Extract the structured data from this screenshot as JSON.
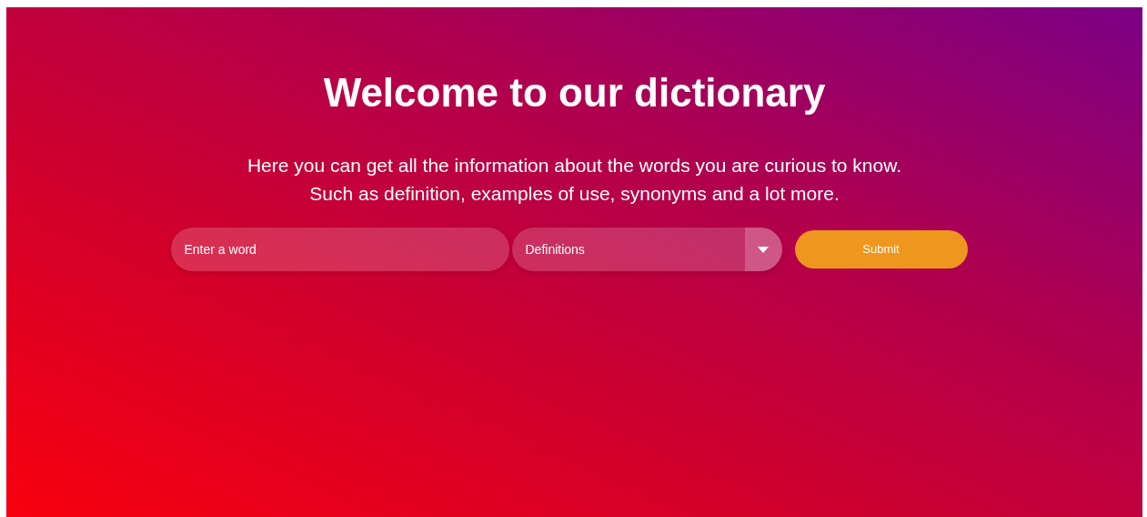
{
  "title": "Welcome to our dictionary",
  "intro": [
    "Here you can get all the information about the words you are curious to know.",
    "Such as definition, examples of use, synonyms and a lot more."
  ],
  "word_field": {
    "placeholder": "Enter a word"
  },
  "type_select": {
    "value": "Definitions"
  },
  "submit_button": {
    "label": "Submit"
  }
}
